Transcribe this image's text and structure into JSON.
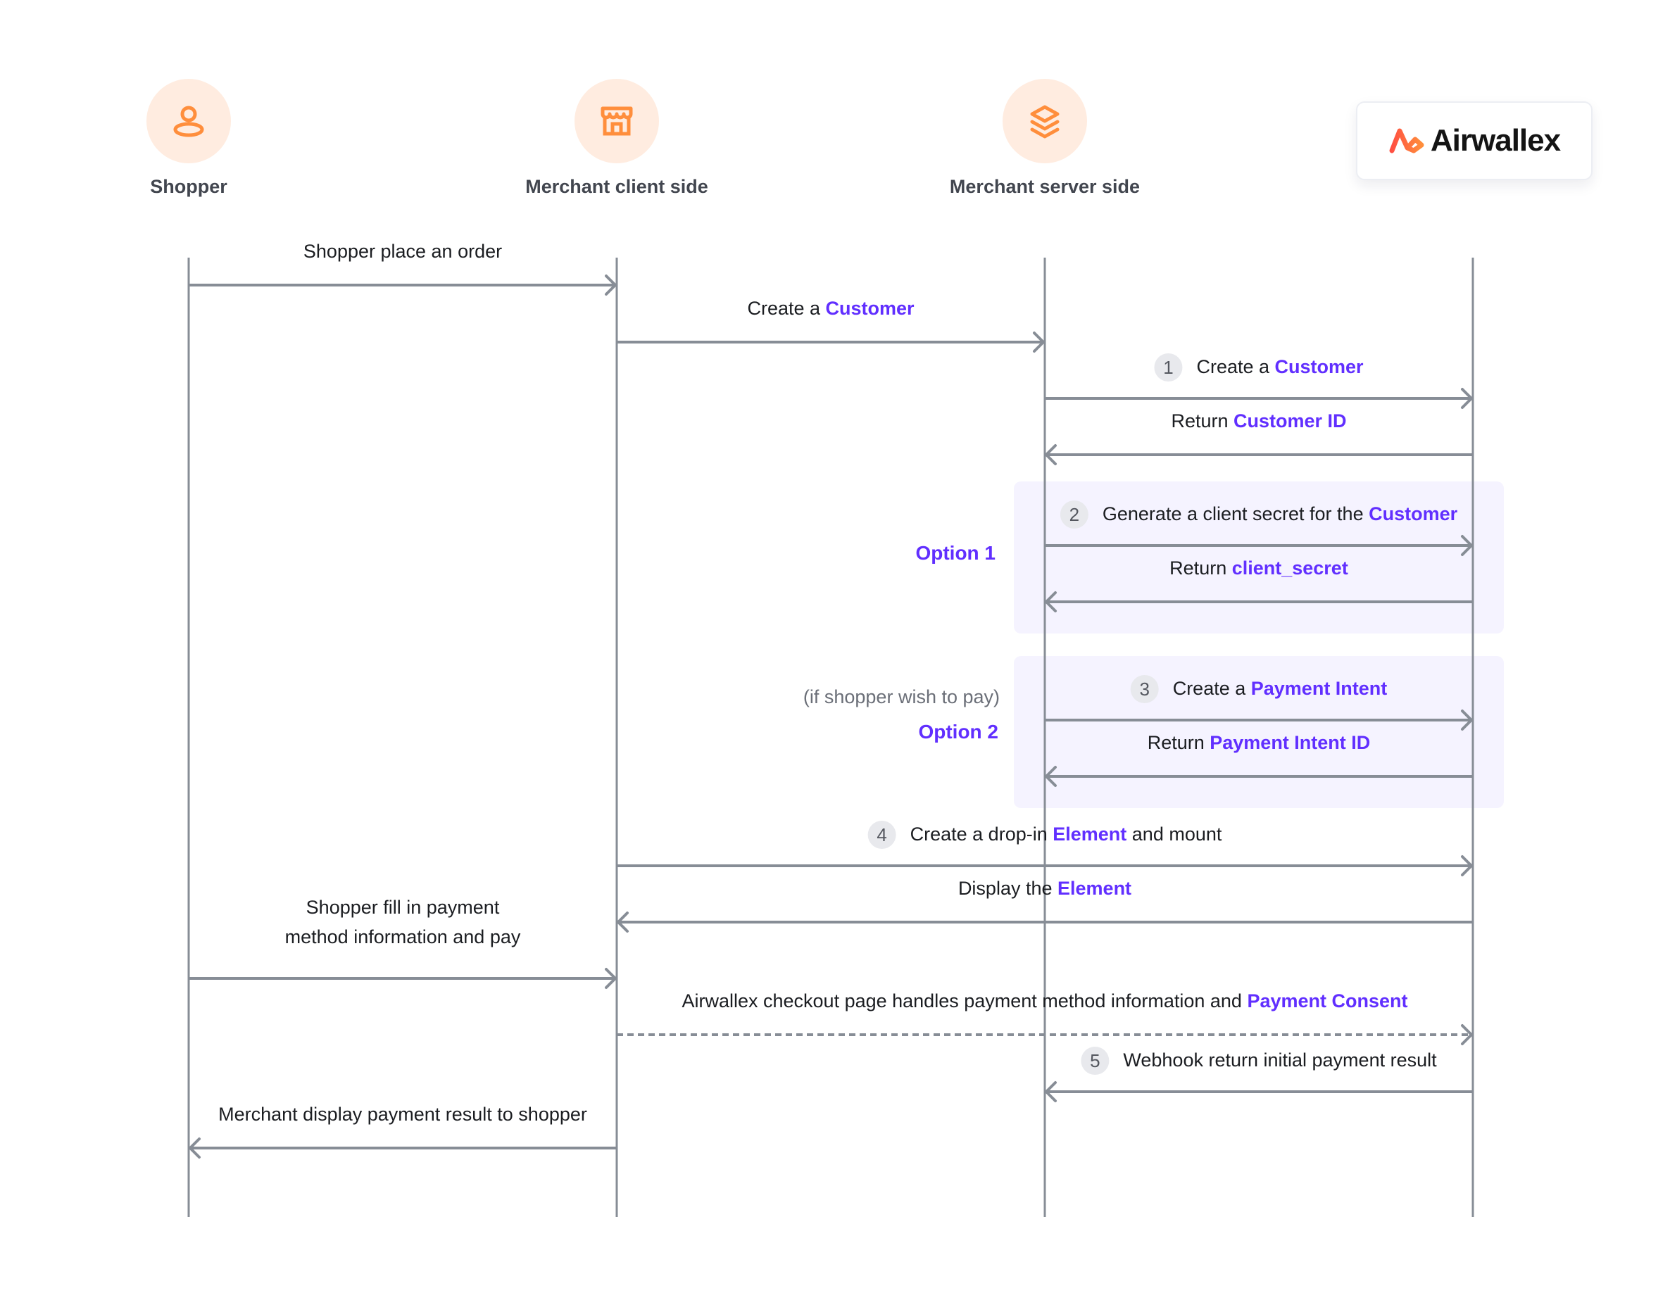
{
  "actors": [
    {
      "id": "shopper",
      "label": "Shopper",
      "icon": "user-icon"
    },
    {
      "id": "client",
      "label": "Merchant client side",
      "icon": "storefront-icon"
    },
    {
      "id": "server",
      "label": "Merchant server side",
      "icon": "layers-icon"
    },
    {
      "id": "airwallex",
      "label": "Airwallex",
      "icon": "airwallex-logo"
    }
  ],
  "colors": {
    "accent": "#612fff",
    "lifeline": "#878d96",
    "avatar_bg": "#ffece0",
    "icon_orange": "#ff8e3c",
    "option_box": "#f3f1ff",
    "step_badge": "#e8e9ed"
  },
  "options": [
    {
      "label": "Option 1",
      "note": ""
    },
    {
      "label": "Option 2",
      "note": "(if shopper wish to pay)"
    }
  ],
  "messages": [
    {
      "from": "shopper",
      "to": "client",
      "style": "solid",
      "step": "",
      "parts": [
        {
          "t": "Shopper place an order"
        }
      ]
    },
    {
      "from": "client",
      "to": "server",
      "style": "solid",
      "step": "",
      "parts": [
        {
          "t": "Create a "
        },
        {
          "t": "Customer",
          "hl": true
        }
      ]
    },
    {
      "from": "server",
      "to": "airwallex",
      "style": "solid",
      "step": "1",
      "parts": [
        {
          "t": "Create a "
        },
        {
          "t": "Customer",
          "hl": true
        }
      ]
    },
    {
      "from": "airwallex",
      "to": "server",
      "style": "solid",
      "step": "",
      "parts": [
        {
          "t": "Return "
        },
        {
          "t": "Customer ID",
          "hl": true
        }
      ]
    },
    {
      "from": "server",
      "to": "airwallex",
      "style": "solid",
      "step": "2",
      "parts": [
        {
          "t": "Generate a client secret for the "
        },
        {
          "t": "Customer",
          "hl": true
        }
      ]
    },
    {
      "from": "airwallex",
      "to": "server",
      "style": "solid",
      "step": "",
      "parts": [
        {
          "t": "Return "
        },
        {
          "t": "client_secret",
          "hl": true
        }
      ]
    },
    {
      "from": "server",
      "to": "airwallex",
      "style": "solid",
      "step": "3",
      "parts": [
        {
          "t": "Create a "
        },
        {
          "t": "Payment Intent",
          "hl": true
        }
      ]
    },
    {
      "from": "airwallex",
      "to": "server",
      "style": "solid",
      "step": "",
      "parts": [
        {
          "t": "Return "
        },
        {
          "t": "Payment Intent ID",
          "hl": true
        }
      ]
    },
    {
      "from": "client",
      "to": "airwallex",
      "style": "solid",
      "step": "4",
      "parts": [
        {
          "t": "Create a drop-in "
        },
        {
          "t": "Element",
          "hl": true
        },
        {
          "t": " and mount"
        }
      ]
    },
    {
      "from": "airwallex",
      "to": "client",
      "style": "solid",
      "step": "",
      "parts": [
        {
          "t": "Display the "
        },
        {
          "t": "Element",
          "hl": true
        }
      ]
    },
    {
      "from": "shopper",
      "to": "client",
      "style": "solid",
      "step": "",
      "lines": [
        "Shopper fill in payment",
        "method information and pay"
      ]
    },
    {
      "from": "client",
      "to": "airwallex",
      "style": "dashed",
      "step": "",
      "parts": [
        {
          "t": "Airwallex checkout page handles payment method information and "
        },
        {
          "t": "Payment Consent",
          "hl": true
        }
      ]
    },
    {
      "from": "airwallex",
      "to": "server",
      "style": "solid",
      "step": "5",
      "parts": [
        {
          "t": "Webhook return initial payment result"
        }
      ]
    },
    {
      "from": "client",
      "to": "shopper",
      "style": "solid",
      "step": "",
      "parts": [
        {
          "t": "Merchant display payment result to shopper"
        }
      ]
    }
  ]
}
